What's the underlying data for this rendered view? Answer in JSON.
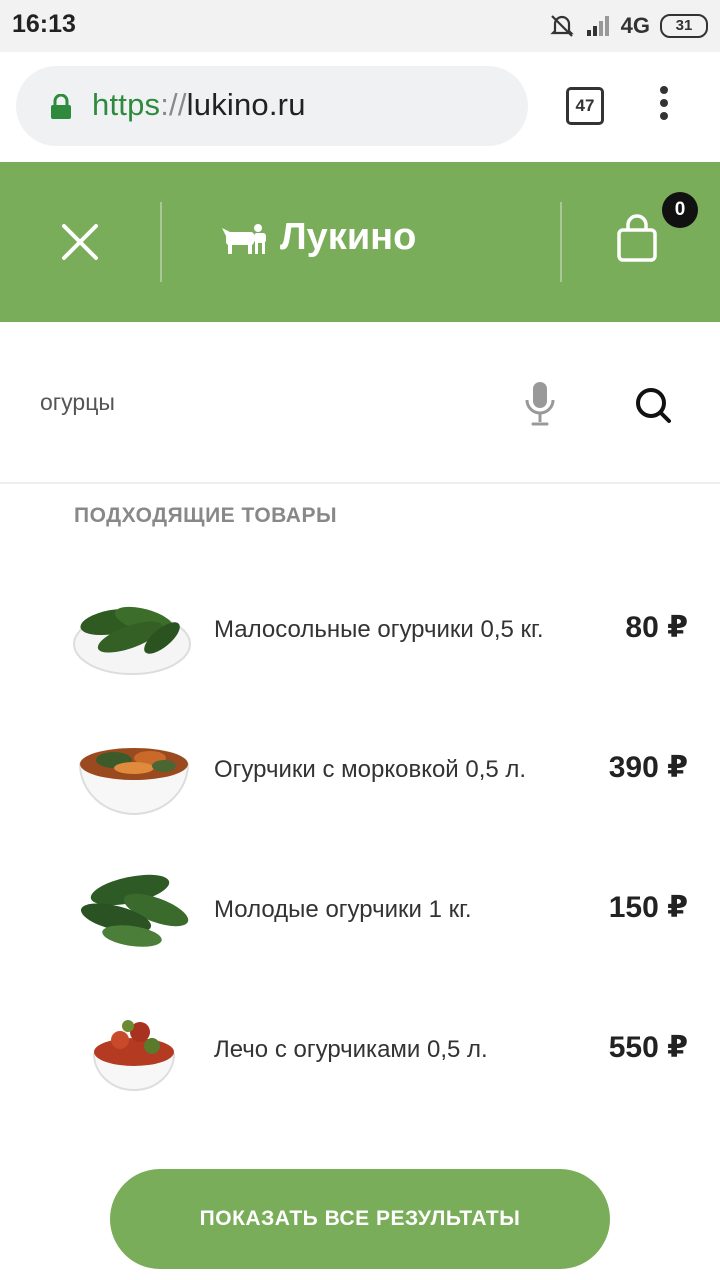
{
  "status_bar": {
    "time": "16:13",
    "network": "4G",
    "battery": "31"
  },
  "browser": {
    "url_scheme": "https",
    "url_separator": "://",
    "url_host": "lukino.ru",
    "tab_count": "47"
  },
  "header": {
    "logo_text": "Лукино",
    "cart_count": "0",
    "accent_color": "#7aad59"
  },
  "search": {
    "query": "огурцы"
  },
  "results": {
    "heading": "ПОДХОДЯЩИЕ ТОВАРЫ",
    "items": [
      {
        "name": "Малосольные огурчики 0,5 кг.",
        "price": "80 ₽",
        "icon": "pickles-bowl"
      },
      {
        "name": "Огурчики с морковкой 0,5 л.",
        "price": "390 ₽",
        "icon": "pickles-carrot-bowl"
      },
      {
        "name": "Молодые огурчики 1 кг.",
        "price": "150 ₽",
        "icon": "fresh-cucumbers"
      },
      {
        "name": "Лечо с огурчиками 0,5 л.",
        "price": "550 ₽",
        "icon": "lecho-bowl"
      }
    ],
    "show_all_label": "ПОКАЗАТЬ ВСЕ РЕЗУЛЬТАТЫ"
  }
}
